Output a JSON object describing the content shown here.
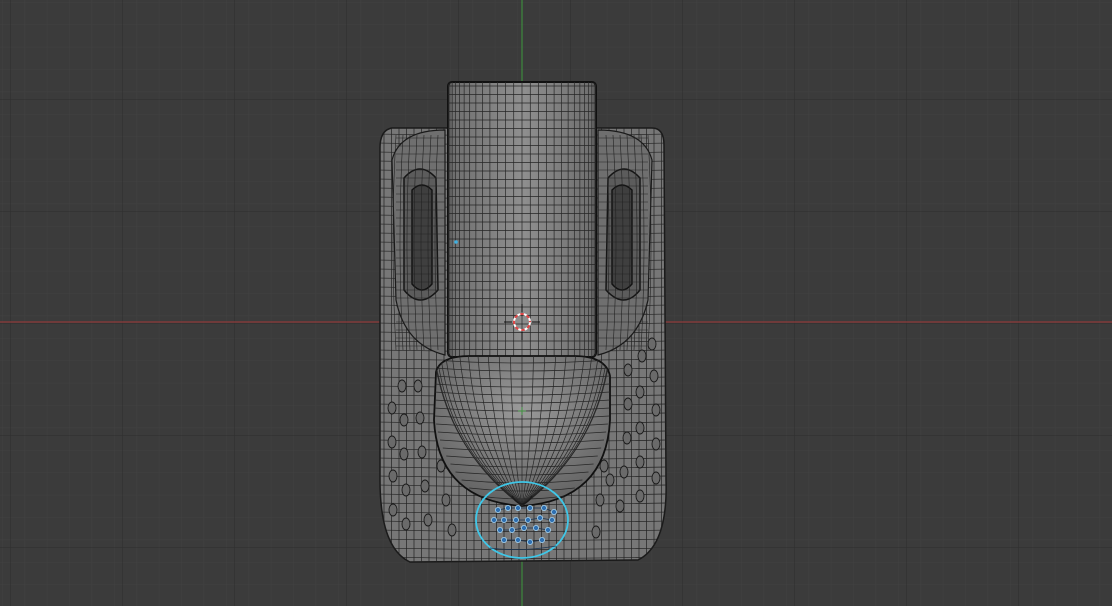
{
  "viewport": {
    "view": "top-orthographic",
    "background_color": "#3b3b3b",
    "grid_minor_color": "#404040",
    "grid_major_color": "#2f2f2f",
    "x_axis_color": "#9a3b3b",
    "y_axis_color": "#3f8f3f",
    "selection_color": "#3fc7e8",
    "vertex_color": "#2f6fb0",
    "cursor_color": "#e04545",
    "mesh_fill_color": "#8a8a8a",
    "wire_color": "#1c1c1c"
  },
  "scene": {
    "objects": [
      {
        "name": "cup-body",
        "shape": "rounded-rectangle",
        "display": "wireframe"
      },
      {
        "name": "handle-left",
        "shape": "rounded-loop",
        "display": "wireframe"
      },
      {
        "name": "handle-right",
        "shape": "rounded-loop",
        "display": "wireframe"
      },
      {
        "name": "cylinder",
        "shape": "cylinder",
        "display": "wireframe"
      },
      {
        "name": "dome",
        "shape": "hemisphere",
        "display": "wireframe"
      },
      {
        "name": "selected-disc",
        "shape": "circle",
        "display": "selected"
      }
    ],
    "cursor_icon": "3d-cursor-icon",
    "origin_icon": "object-origin-icon"
  }
}
